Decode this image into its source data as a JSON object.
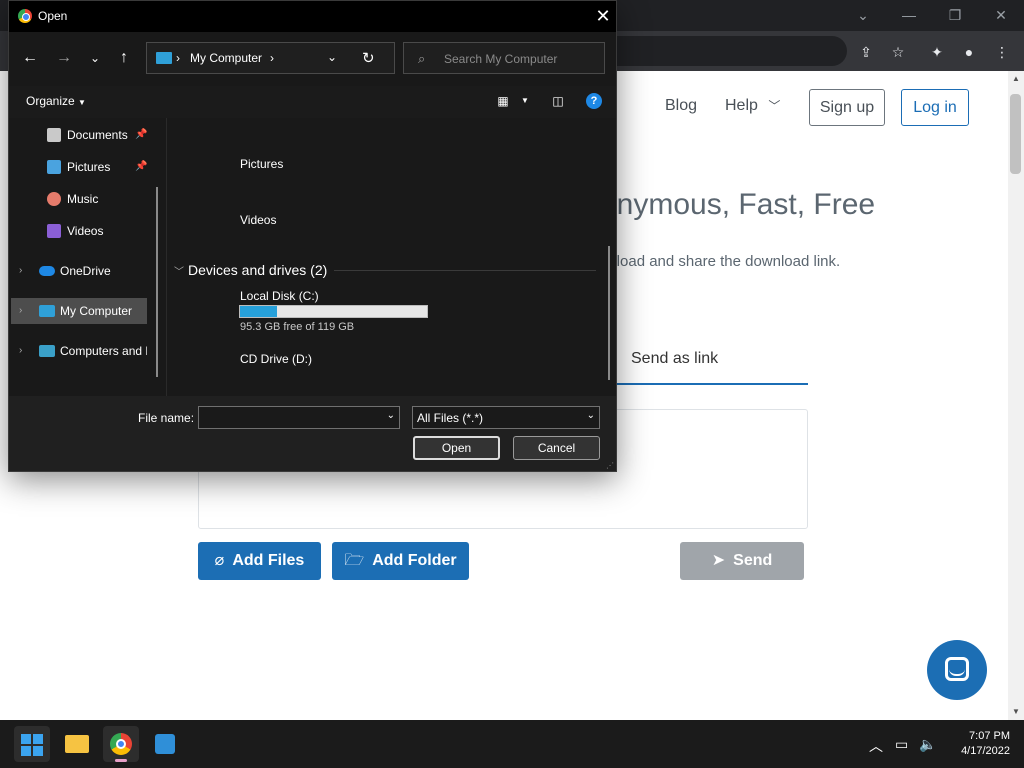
{
  "browser": {
    "window_controls": [
      "˅",
      "—",
      "❐",
      "✕"
    ],
    "toolbar_icons": [
      "share-icon",
      "star-icon",
      "extensions-icon",
      "profile-icon",
      "menu-icon"
    ]
  },
  "site": {
    "nav": {
      "blog": "Blog",
      "help": "Help",
      "signup": "Sign up",
      "login": "Log in"
    },
    "hero_title": "onymous, Fast, Free",
    "hero_sub": "upload and share the download link.",
    "tab_send_link": "Send as link",
    "buttons": {
      "add_files": "Add Files",
      "add_folder": "Add Folder",
      "send": "Send"
    },
    "colors": {
      "primary": "#1c6eb4",
      "disabled": "#a0a5aa"
    }
  },
  "dialog": {
    "title": "Open",
    "address": {
      "location": "My Computer"
    },
    "search_placeholder": "Search My Computer",
    "organize": "Organize",
    "nav_pane": [
      {
        "label": "Documents",
        "pinned": true
      },
      {
        "label": "Pictures",
        "pinned": true
      },
      {
        "label": "Music"
      },
      {
        "label": "Videos"
      },
      {
        "label": "OneDrive"
      },
      {
        "label": "My Computer",
        "selected": true
      },
      {
        "label": "Computers and D"
      }
    ],
    "folders": [
      "Pictures",
      "Videos"
    ],
    "group_header": "Devices and drives (2)",
    "drives": [
      {
        "label": "Local Disk (C:)",
        "free_text": "95.3 GB free of 119 GB",
        "used_fraction": 0.2
      },
      {
        "label": "CD Drive (D:)"
      }
    ],
    "file_name_label": "File name:",
    "file_name_value": "",
    "filter": "All Files (*.*)",
    "open_button": "Open",
    "cancel_button": "Cancel"
  },
  "taskbar": {
    "time": "7:07 PM",
    "date": "4/17/2022"
  }
}
